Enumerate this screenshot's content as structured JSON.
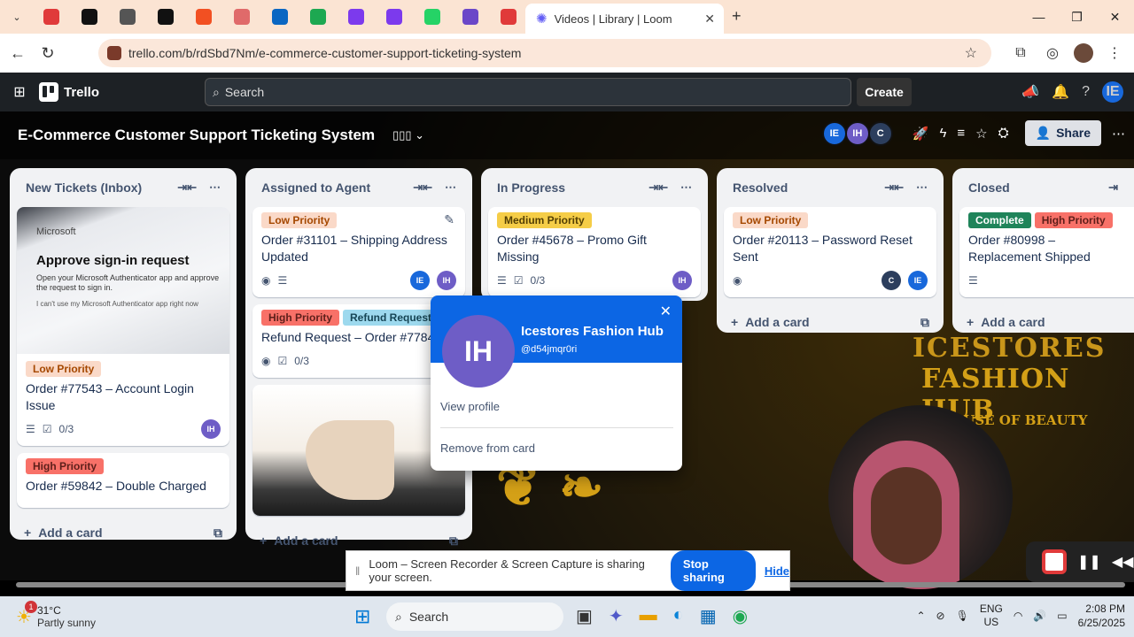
{
  "browser": {
    "active_tab_title": "Videos | Library | Loom",
    "url": "trello.com/b/rdSbd7Nm/e-commerce-customer-support-ticketing-system",
    "tab_icon_colors": [
      "#e03a3a",
      "#111111",
      "#555555",
      "#111111",
      "#f25022",
      "#e06a6a",
      "#0a66c2",
      "#1da851",
      "#7c3aed",
      "#7c3aed",
      "#25d366",
      "#6b47c8",
      "#e03a3a"
    ]
  },
  "trello": {
    "app_name": "Trello",
    "search_placeholder": "Search",
    "create_label": "Create",
    "user_initials": "IE"
  },
  "board": {
    "title": "E-Commerce Customer Support Ticketing System",
    "members": [
      "IE",
      "IH",
      "C"
    ],
    "share_label": "Share",
    "bg_text_1": "ICESTORES",
    "bg_text_2": "FASHION HUB",
    "bg_text_3": "HOUSE OF BEAUTY"
  },
  "lists": [
    {
      "name": "New Tickets (Inbox)",
      "add_card": "Add a card",
      "cards": [
        {
          "cover_title": "Microsoft",
          "cover_heading": "Approve sign-in request",
          "cover_body": "Open your Microsoft Authenticator app and approve the request to sign in.",
          "cover_foot": "I can't use my Microsoft Authenticator app right now",
          "labels": [
            {
              "text": "Low Priority",
              "kind": "low"
            }
          ],
          "title": "Order #77543 – Account Login Issue",
          "checklist": "0/3",
          "members": [
            "IH"
          ]
        },
        {
          "labels": [
            {
              "text": "High Priority",
              "kind": "high"
            }
          ],
          "title": "Order #59842 – Double Charged"
        }
      ]
    },
    {
      "name": "Assigned to Agent",
      "add_card": "Add a card",
      "cards": [
        {
          "labels": [
            {
              "text": "Low Priority",
              "kind": "low"
            }
          ],
          "title": "Order #31101 – Shipping Address Updated",
          "members": [
            "IE",
            "IH"
          ]
        },
        {
          "labels": [
            {
              "text": "High Priority",
              "kind": "high"
            },
            {
              "text": "Refund Request",
              "kind": "refund"
            }
          ],
          "title": "Refund Request – Order #77841",
          "checklist": "0/3"
        }
      ]
    },
    {
      "name": "In Progress",
      "cards": [
        {
          "labels": [
            {
              "text": "Medium Priority",
              "kind": "med"
            }
          ],
          "title": "Order #45678 – Promo Gift Missing",
          "checklist": "0/3",
          "members": [
            "IH"
          ]
        }
      ]
    },
    {
      "name": "Resolved",
      "add_card": "Add a card",
      "cards": [
        {
          "labels": [
            {
              "text": "Low Priority",
              "kind": "low"
            }
          ],
          "title": "Order #20113 – Password Reset Sent",
          "members": [
            "C",
            "IE"
          ]
        }
      ]
    },
    {
      "name": "Closed",
      "add_card": "Add a card",
      "cards": [
        {
          "labels": [
            {
              "text": "Complete",
              "kind": "complete"
            },
            {
              "text": "High Priority",
              "kind": "high"
            }
          ],
          "title": "Order #80998 – Replacement Shipped"
        }
      ]
    }
  ],
  "member_popup": {
    "initials": "IH",
    "name": "Icestores Fashion Hub",
    "handle": "@d54jmqr0ri",
    "view_profile": "View profile",
    "remove": "Remove from card"
  },
  "loom": {
    "sharing_text": "Loom – Screen Recorder & Screen Capture is sharing your screen.",
    "stop_label": "Stop sharing",
    "hide_label": "Hide"
  },
  "taskbar": {
    "temperature": "31°C",
    "weather": "Partly sunny",
    "notification_count": "1",
    "search_label": "Search",
    "lang_1": "ENG",
    "lang_2": "US",
    "time": "2:08 PM",
    "date": "6/25/2025"
  }
}
